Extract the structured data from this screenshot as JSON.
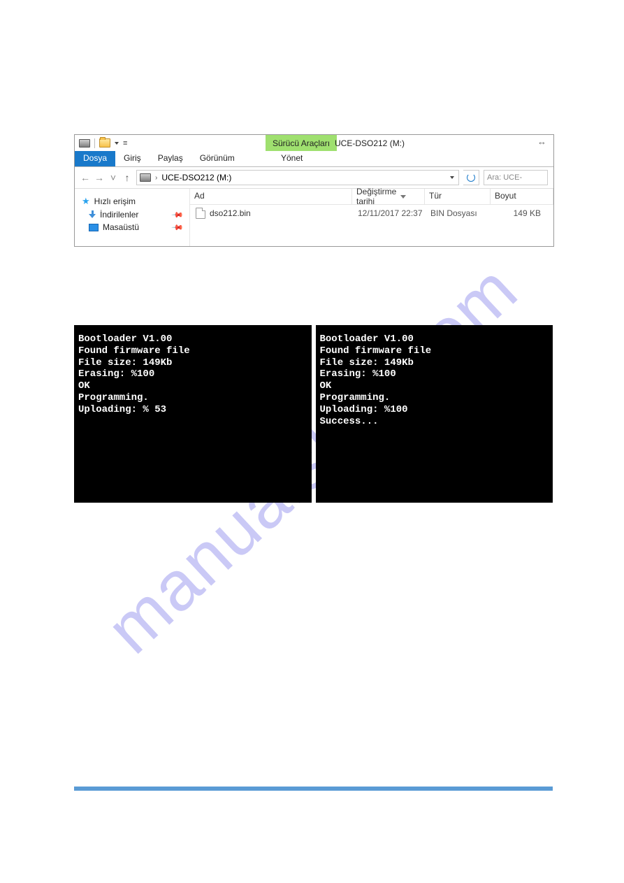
{
  "explorer": {
    "context_tab": "Sürücü Araçları",
    "window_title": "UCE-DSO212 (M:)",
    "ribbon": {
      "file": "Dosya",
      "home": "Giriş",
      "share": "Paylaş",
      "view": "Görünüm",
      "manage": "Yönet"
    },
    "address_path": "UCE-DSO212 (M:)",
    "search_placeholder": "Ara: UCE-",
    "nav": {
      "quick_access": "Hızlı erişim",
      "downloads": "İndirilenler",
      "desktop": "Masaüstü"
    },
    "columns": {
      "name": "Ad",
      "date": "Değiştirme tarihi",
      "type": "Tür",
      "size": "Boyut"
    },
    "rows": [
      {
        "name": "dso212.bin",
        "date": "12/11/2017 22:37",
        "type": "BIN Dosyası",
        "size": "149 KB"
      }
    ]
  },
  "consoles": {
    "left": "Bootloader V1.00\nFound firmware file\nFile size: 149Kb\nErasing: %100\nOK\nProgramming.\nUploading: % 53",
    "right": "Bootloader V1.00\nFound firmware file\nFile size: 149Kb\nErasing: %100\nOK\nProgramming.\nUploading: %100\nSuccess..."
  },
  "watermark": "manualshift.com"
}
